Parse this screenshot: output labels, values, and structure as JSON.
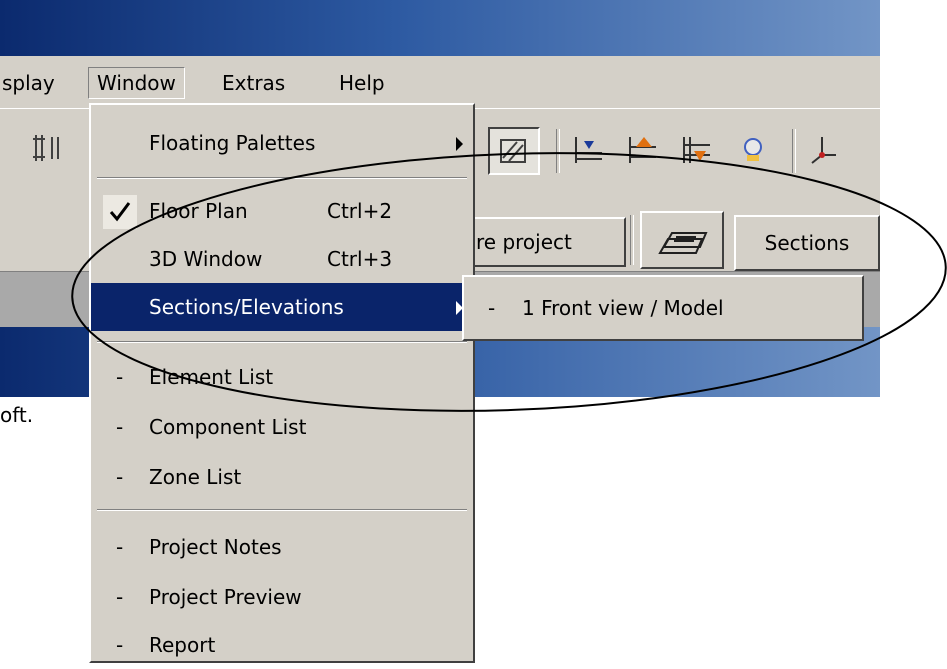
{
  "menubar": {
    "items": [
      {
        "label": "splay"
      },
      {
        "label": "Window"
      },
      {
        "label": "Extras"
      },
      {
        "label": "Help"
      }
    ]
  },
  "toolbar2": {
    "project_label": "re project",
    "sections_label": "Sections"
  },
  "statusbar": {
    "text": "oft."
  },
  "window_menu": {
    "floating_palettes": {
      "label": "Floating Palettes"
    },
    "floor_plan": {
      "label": "Floor Plan",
      "accel": "Ctrl+2",
      "checked": true
    },
    "window_3d": {
      "label": "3D Window",
      "accel": "Ctrl+3"
    },
    "sections_elevations": {
      "label": "Sections/Elevations",
      "highlighted": true
    },
    "list_items": [
      {
        "dash": "-",
        "label": "Element List"
      },
      {
        "dash": "-",
        "label": "Component List"
      },
      {
        "dash": "-",
        "label": "Zone List"
      }
    ],
    "project_items": [
      {
        "dash": "-",
        "label": "Project Notes"
      },
      {
        "dash": "-",
        "label": "Project Preview"
      },
      {
        "dash": "-",
        "label": "Report"
      }
    ]
  },
  "submenu": {
    "items": [
      {
        "dash": "-",
        "label": "1 Front view / Model"
      }
    ]
  },
  "colors": {
    "menu_bg": "#d4d0c8",
    "highlight": "#0a246a",
    "titlebar": "#2d5aa2"
  },
  "icons": {
    "toolbar1": [
      "fit-window-icon",
      "hatch-pattern-icon",
      "level-dimension-icon",
      "elevation-up-icon",
      "elevation-down-icon",
      "navigator-icon",
      "axis-icon"
    ],
    "toolbar2": [
      "section-marker-icon"
    ]
  }
}
